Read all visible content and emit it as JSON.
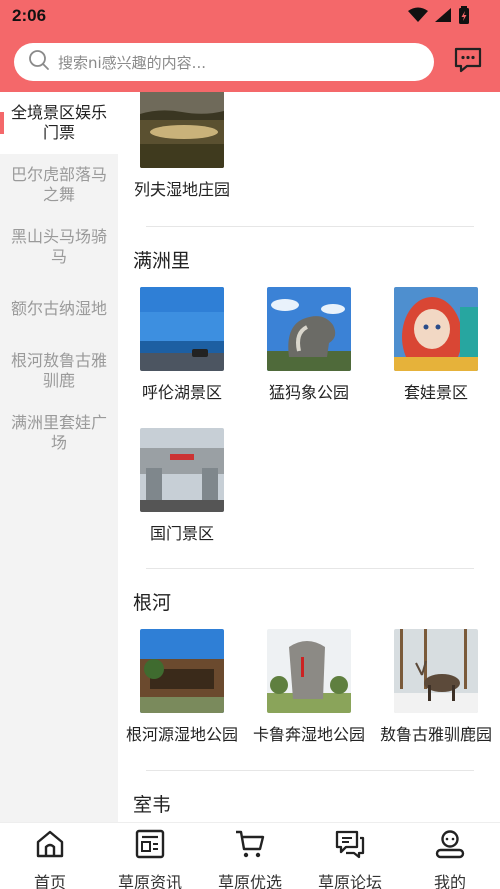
{
  "status_bar": {
    "time": "2:06"
  },
  "search": {
    "placeholder": "搜索ni感兴趣的内容..."
  },
  "sidebar": {
    "items": [
      {
        "label": "全境景区娱乐门票",
        "active": true
      },
      {
        "label": "巴尔虎部落马之舞",
        "active": false
      },
      {
        "label": "黑山头马场骑马",
        "active": false
      },
      {
        "label": "额尔古纳湿地",
        "active": false
      },
      {
        "label": "根河敖鲁古雅驯鹿",
        "active": false
      },
      {
        "label": "满洲里套娃广场",
        "active": false
      }
    ]
  },
  "main": {
    "top_item": {
      "label": "列夫湿地庄园",
      "icon": "grassland-photo"
    },
    "sections": [
      {
        "title": "满洲里",
        "items": [
          {
            "label": "呼伦湖景区",
            "icon": "lake-photo"
          },
          {
            "label": "猛犸象公园",
            "icon": "mammoth-photo"
          },
          {
            "label": "套娃景区",
            "icon": "matryoshka-photo"
          },
          {
            "label": "国门景区",
            "icon": "gate-photo"
          }
        ]
      },
      {
        "title": "根河",
        "items": [
          {
            "label": "根河源湿地公园",
            "icon": "building-photo"
          },
          {
            "label": "卡鲁奔湿地公园",
            "icon": "stone-photo"
          },
          {
            "label": "敖鲁古雅驯鹿园",
            "icon": "reindeer-photo"
          }
        ]
      },
      {
        "title": "室韦",
        "items": []
      }
    ]
  },
  "bottom_nav": [
    {
      "label": "首页",
      "icon": "home-icon"
    },
    {
      "label": "草原资讯",
      "icon": "news-icon"
    },
    {
      "label": "草原优选",
      "icon": "cart-icon"
    },
    {
      "label": "草原论坛",
      "icon": "forum-icon"
    },
    {
      "label": "我的",
      "icon": "profile-icon"
    }
  ],
  "colors": {
    "accent": "#f4686a",
    "sidebar_bg": "#f3f3f3",
    "inactive_text": "#9a9a9a"
  }
}
